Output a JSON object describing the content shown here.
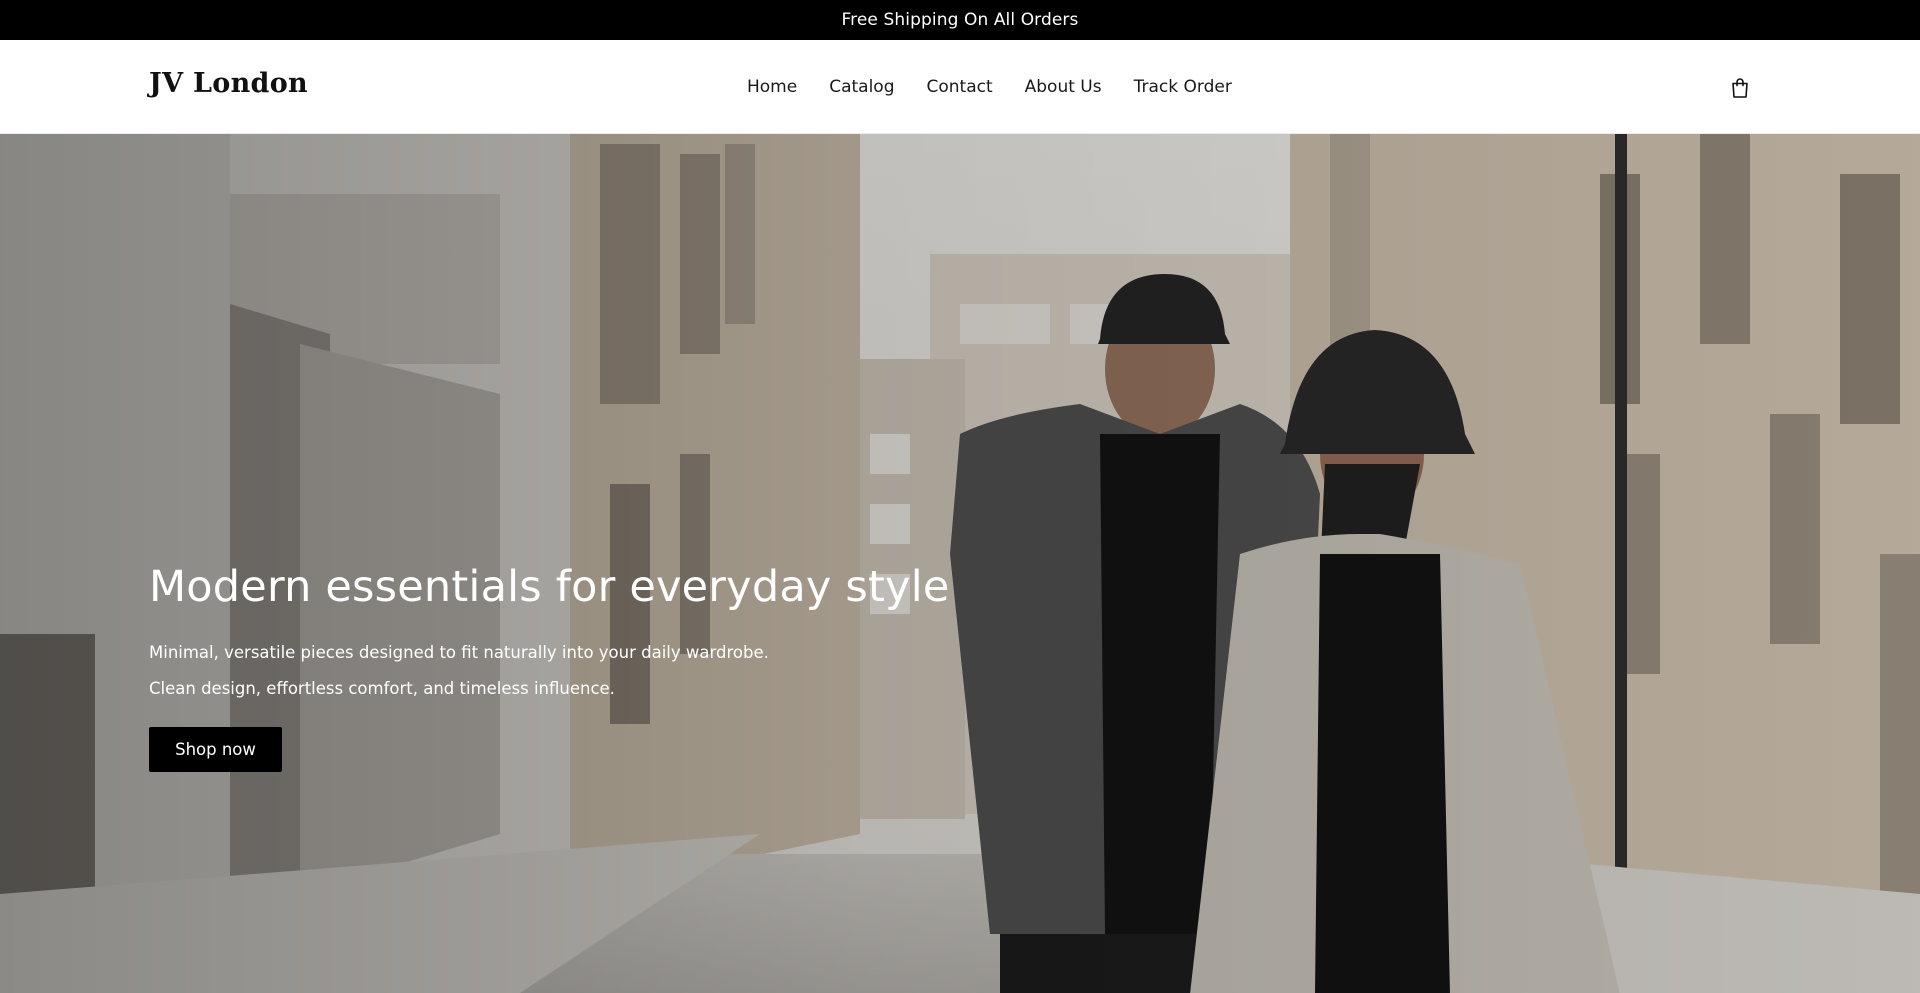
{
  "announcement": {
    "text": "Free Shipping On All Orders"
  },
  "header": {
    "logo": "JV London",
    "nav": [
      {
        "label": "Home"
      },
      {
        "label": "Catalog"
      },
      {
        "label": "Contact"
      },
      {
        "label": "About Us"
      },
      {
        "label": "Track Order"
      }
    ],
    "cart_icon": "shopping-bag-icon"
  },
  "hero": {
    "image": "hero-photo: two models in dark caps and coats on a city street",
    "title": "Modern essentials for everyday style",
    "subtitle_line1": "Minimal, versatile pieces designed to fit naturally into your daily wardrobe.",
    "subtitle_line2": "Clean design, effortless comfort, and timeless influence.",
    "button_label": "Shop now"
  },
  "colors": {
    "announcement_bg": "#000000",
    "header_bg": "#ffffff",
    "button_bg": "#000000",
    "text_on_dark": "#ffffff"
  }
}
